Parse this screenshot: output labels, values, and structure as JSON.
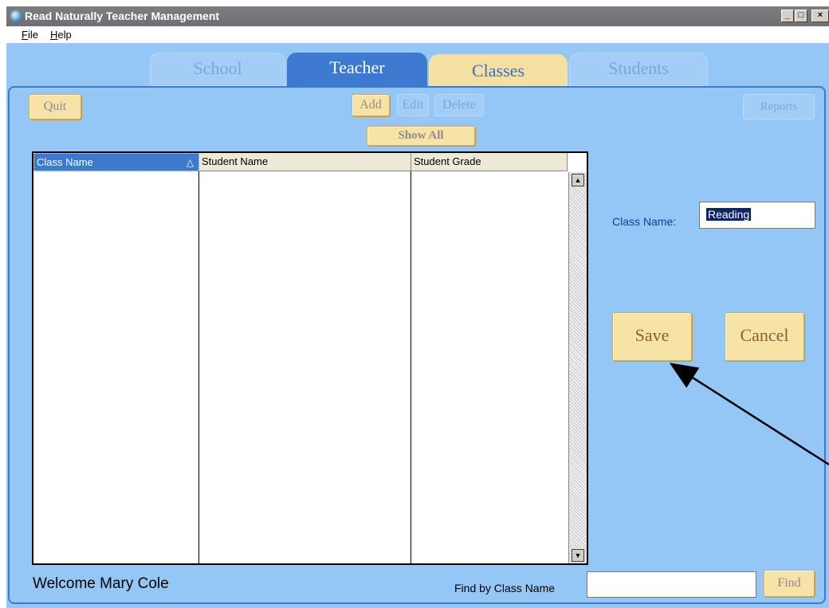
{
  "window": {
    "title": "Read Naturally Teacher Management",
    "minimize_glyph": "_",
    "maximize_glyph": "□",
    "close_glyph": "×"
  },
  "menu": {
    "file": "File",
    "help": "Help"
  },
  "tabs": {
    "school": "School",
    "teacher": "Teacher",
    "classes": "Classes",
    "students": "Students"
  },
  "toolbar": {
    "quit": "Quit",
    "add": "Add",
    "edit": "Edit",
    "delete": "Delete",
    "reports": "Reports",
    "show_all": "Show All"
  },
  "table": {
    "columns": [
      "Class Name",
      "Student Name",
      "Student Grade"
    ],
    "sort_glyph": "△",
    "scroll_up": "▲",
    "scroll_down": "▼",
    "rows": []
  },
  "form": {
    "class_name_label": "Class Name:",
    "class_name_value": "Reading",
    "save": "Save",
    "cancel": "Cancel"
  },
  "footer": {
    "welcome": "Welcome Mary Cole",
    "find_label": "Find by Class Name",
    "find_value": "",
    "find_button": "Find"
  },
  "colors": {
    "background": "#94c6f6",
    "active_tab": "#3d79cf",
    "button": "#f7e3a6",
    "title_bar": "#767779"
  },
  "icons": {
    "app": "read-naturally-app-icon",
    "cursor": "mouse-cursor"
  }
}
